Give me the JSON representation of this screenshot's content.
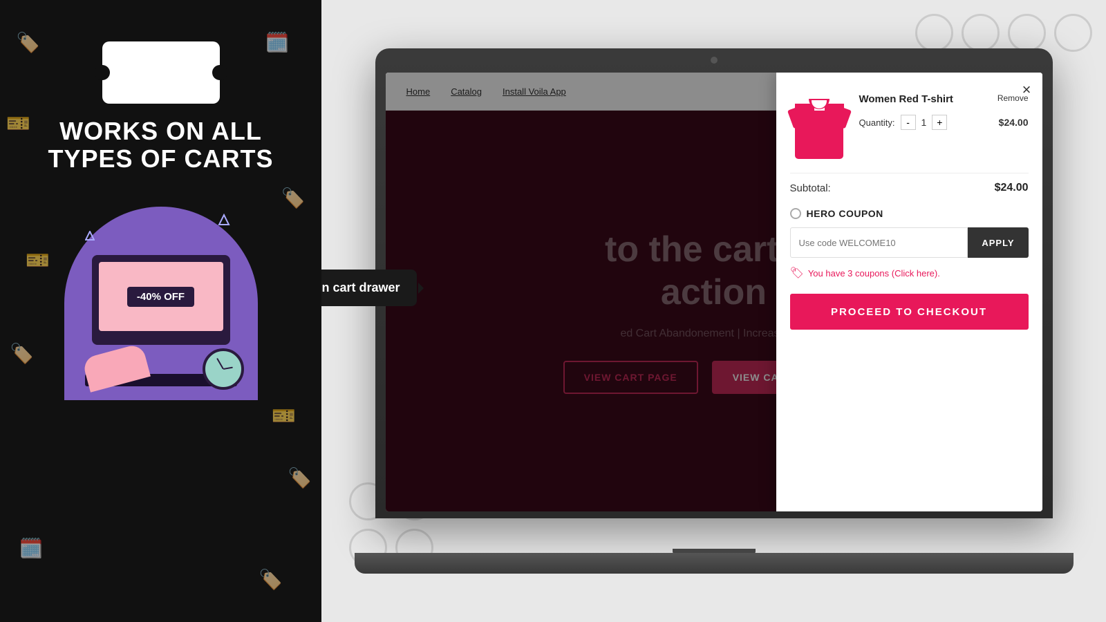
{
  "left": {
    "coupon_symbol": "%",
    "heading_line1": "WORKS ON ALL",
    "heading_line2": "TYPES OF CARTS",
    "discount_badge": "-40% OFF"
  },
  "right": {
    "nav": {
      "items": [
        "Home",
        "Catalog",
        "Install Voila App"
      ]
    },
    "store_headline_line1": "to the cart to",
    "store_headline_line2": "action",
    "store_subtitle": "ed Cart Abandonement | Increased Ac",
    "cart_buttons": {
      "view_cart_page": "VIEW CART PAGE",
      "view_cart_drawer": "VIEW CART DRAWER"
    }
  },
  "drawer": {
    "close_label": "×",
    "product": {
      "name": "Women Red T-shirt",
      "remove_label": "Remove",
      "quantity_label": "Quantity:",
      "qty_minus": "-",
      "qty_value": "1",
      "qty_plus": "+",
      "price": "$24.00"
    },
    "subtotal": {
      "label": "Subtotal:",
      "amount": "$24.00"
    },
    "coupon": {
      "hero_label": "HERO COUPON",
      "input_placeholder": "Use code WELCOME10",
      "apply_label": "APPLY",
      "coupons_text": "You have 3 coupons (Click here)."
    },
    "checkout_label": "PROCEED TO CHECKOUT"
  },
  "tooltip": {
    "text": "Coupon on cart drawer"
  }
}
